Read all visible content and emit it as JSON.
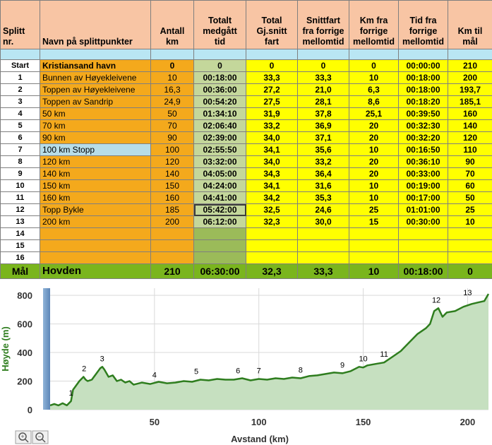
{
  "table": {
    "headers": [
      "Splitt nr.",
      "Navn på splittpunkter",
      "Antall km",
      "Totalt medgått tid",
      "Total Gj.snitt fart",
      "Snittfart fra forrige mellomtid",
      "Km fra forrige mellomtid",
      "Tid fra forrige mellomtid",
      "Km til mål"
    ],
    "rows": [
      [
        "Start",
        "Kristiansand havn",
        "0",
        "0",
        "0",
        "0",
        "0",
        "00:00:00",
        "210"
      ],
      [
        "1",
        "Bunnen av Høyekleivene",
        "10",
        "00:18:00",
        "33,3",
        "33,3",
        "10",
        "00:18:00",
        "200"
      ],
      [
        "2",
        "Toppen av Høyekleivene",
        "16,3",
        "00:36:00",
        "27,2",
        "21,0",
        "6,3",
        "00:18:00",
        "193,7"
      ],
      [
        "3",
        "Toppen av Sandrip",
        "24,9",
        "00:54:20",
        "27,5",
        "28,1",
        "8,6",
        "00:18:20",
        "185,1"
      ],
      [
        "4",
        "50 km",
        "50",
        "01:34:10",
        "31,9",
        "37,8",
        "25,1",
        "00:39:50",
        "160"
      ],
      [
        "5",
        "70 km",
        "70",
        "02:06:40",
        "33,2",
        "36,9",
        "20",
        "00:32:30",
        "140"
      ],
      [
        "6",
        "90 km",
        "90",
        "02:39:00",
        "34,0",
        "37,1",
        "20",
        "00:32:20",
        "120"
      ],
      [
        "7",
        "100 km Stopp",
        "100",
        "02:55:50",
        "34,1",
        "35,6",
        "10",
        "00:16:50",
        "110"
      ],
      [
        "8",
        "120 km",
        "120",
        "03:32:00",
        "34,0",
        "33,2",
        "20",
        "00:36:10",
        "90"
      ],
      [
        "9",
        "140 km",
        "140",
        "04:05:00",
        "34,3",
        "36,4",
        "20",
        "00:33:00",
        "70"
      ],
      [
        "10",
        "150 km",
        "150",
        "04:24:00",
        "34,1",
        "31,6",
        "10",
        "00:19:00",
        "60"
      ],
      [
        "11",
        "160 km",
        "160",
        "04:41:00",
        "34,2",
        "35,3",
        "10",
        "00:17:00",
        "50"
      ],
      [
        "12",
        "Topp Bykle",
        "185",
        "05:42:00",
        "32,5",
        "24,6",
        "25",
        "01:01:00",
        "25"
      ],
      [
        "13",
        "200 km",
        "200",
        "06:12:00",
        "32,3",
        "30,0",
        "15",
        "00:30:00",
        "10"
      ],
      [
        "14",
        "",
        "",
        "",
        "",
        "",
        "",
        "",
        ""
      ],
      [
        "15",
        "",
        "",
        "",
        "",
        "",
        "",
        "",
        ""
      ],
      [
        "16",
        "",
        "",
        "",
        "",
        "",
        "",
        "",
        ""
      ],
      [
        "Mål",
        "Hovden",
        "210",
        "06:30:00",
        "32,3",
        "33,3",
        "10",
        "00:18:00",
        "0"
      ]
    ]
  },
  "chart_data": {
    "type": "area",
    "xlabel": "Avstand (km)",
    "ylabel": "Høyde (m)",
    "xlim": [
      0,
      210
    ],
    "ylim": [
      0,
      850
    ],
    "xticks": [
      50,
      100,
      150,
      200
    ],
    "yticks": [
      0,
      200,
      400,
      600,
      800
    ],
    "color": "#2e7d1e",
    "fill": "#c6e0c0",
    "series": [
      {
        "x": [
          0,
          2,
          4,
          6,
          8,
          10,
          11,
          12,
          14,
          16,
          17,
          18,
          20,
          22,
          24,
          25,
          26,
          28,
          30,
          32,
          34,
          36,
          38,
          40,
          44,
          48,
          52,
          56,
          60,
          64,
          68,
          72,
          76,
          80,
          84,
          88,
          92,
          96,
          100,
          104,
          108,
          112,
          116,
          120,
          124,
          128,
          132,
          136,
          140,
          144,
          148,
          150,
          152,
          156,
          160,
          164,
          168,
          172,
          176,
          180,
          182,
          184,
          186,
          188,
          190,
          194,
          198,
          202,
          205,
          208,
          210
        ],
        "y": [
          30,
          40,
          30,
          45,
          30,
          60,
          140,
          160,
          200,
          230,
          210,
          200,
          210,
          250,
          290,
          300,
          280,
          230,
          240,
          200,
          210,
          190,
          200,
          175,
          190,
          180,
          195,
          185,
          190,
          200,
          195,
          210,
          205,
          215,
          210,
          210,
          220,
          205,
          215,
          210,
          220,
          215,
          225,
          220,
          235,
          240,
          250,
          260,
          255,
          270,
          300,
          295,
          310,
          320,
          330,
          370,
          410,
          470,
          530,
          570,
          600,
          690,
          710,
          650,
          680,
          690,
          720,
          740,
          750,
          760,
          810
        ]
      }
    ],
    "annotations": [
      {
        "label": "1",
        "x": 10,
        "y": 60
      },
      {
        "label": "2",
        "x": 16.3,
        "y": 230
      },
      {
        "label": "3",
        "x": 24.9,
        "y": 300
      },
      {
        "label": "4",
        "x": 50,
        "y": 185
      },
      {
        "label": "5",
        "x": 70,
        "y": 210
      },
      {
        "label": "6",
        "x": 90,
        "y": 215
      },
      {
        "label": "7",
        "x": 100,
        "y": 215
      },
      {
        "label": "8",
        "x": 120,
        "y": 220
      },
      {
        "label": "9",
        "x": 140,
        "y": 255
      },
      {
        "label": "10",
        "x": 150,
        "y": 300
      },
      {
        "label": "11",
        "x": 160,
        "y": 330
      },
      {
        "label": "12",
        "x": 185,
        "y": 710
      },
      {
        "label": "13",
        "x": 200,
        "y": 760
      }
    ]
  },
  "controls": {
    "zoom_in": "+",
    "zoom_out": "−"
  }
}
